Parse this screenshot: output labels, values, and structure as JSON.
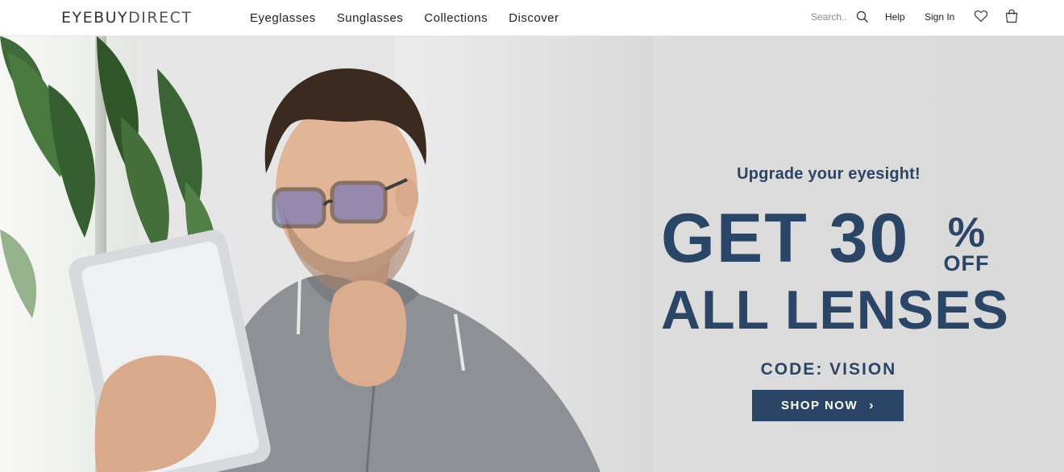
{
  "brand": {
    "part1": "EYEBUY",
    "part2": "DIRECT"
  },
  "nav": {
    "items": [
      {
        "label": "Eyeglasses"
      },
      {
        "label": "Sunglasses"
      },
      {
        "label": "Collections"
      },
      {
        "label": "Discover"
      }
    ]
  },
  "search": {
    "placeholder": "Search.."
  },
  "utility": {
    "help": "Help",
    "sign_in": "Sign In"
  },
  "icons": {
    "search": "search-icon",
    "wishlist": "heart-icon",
    "cart": "shopping-bag-icon"
  },
  "hero": {
    "tagline": "Upgrade your eyesight!",
    "headline_line1": "GET 30",
    "percent": "%",
    "off": "OFF",
    "headline_line2": "ALL LENSES",
    "code_label": "CODE:",
    "code_value": "VISION",
    "cta_label": "SHOP NOW",
    "cta_chevron": "›"
  },
  "colors": {
    "accent": "#2b4566",
    "hero_bg": "#dcdcdc",
    "header_bg": "#ffffff"
  }
}
